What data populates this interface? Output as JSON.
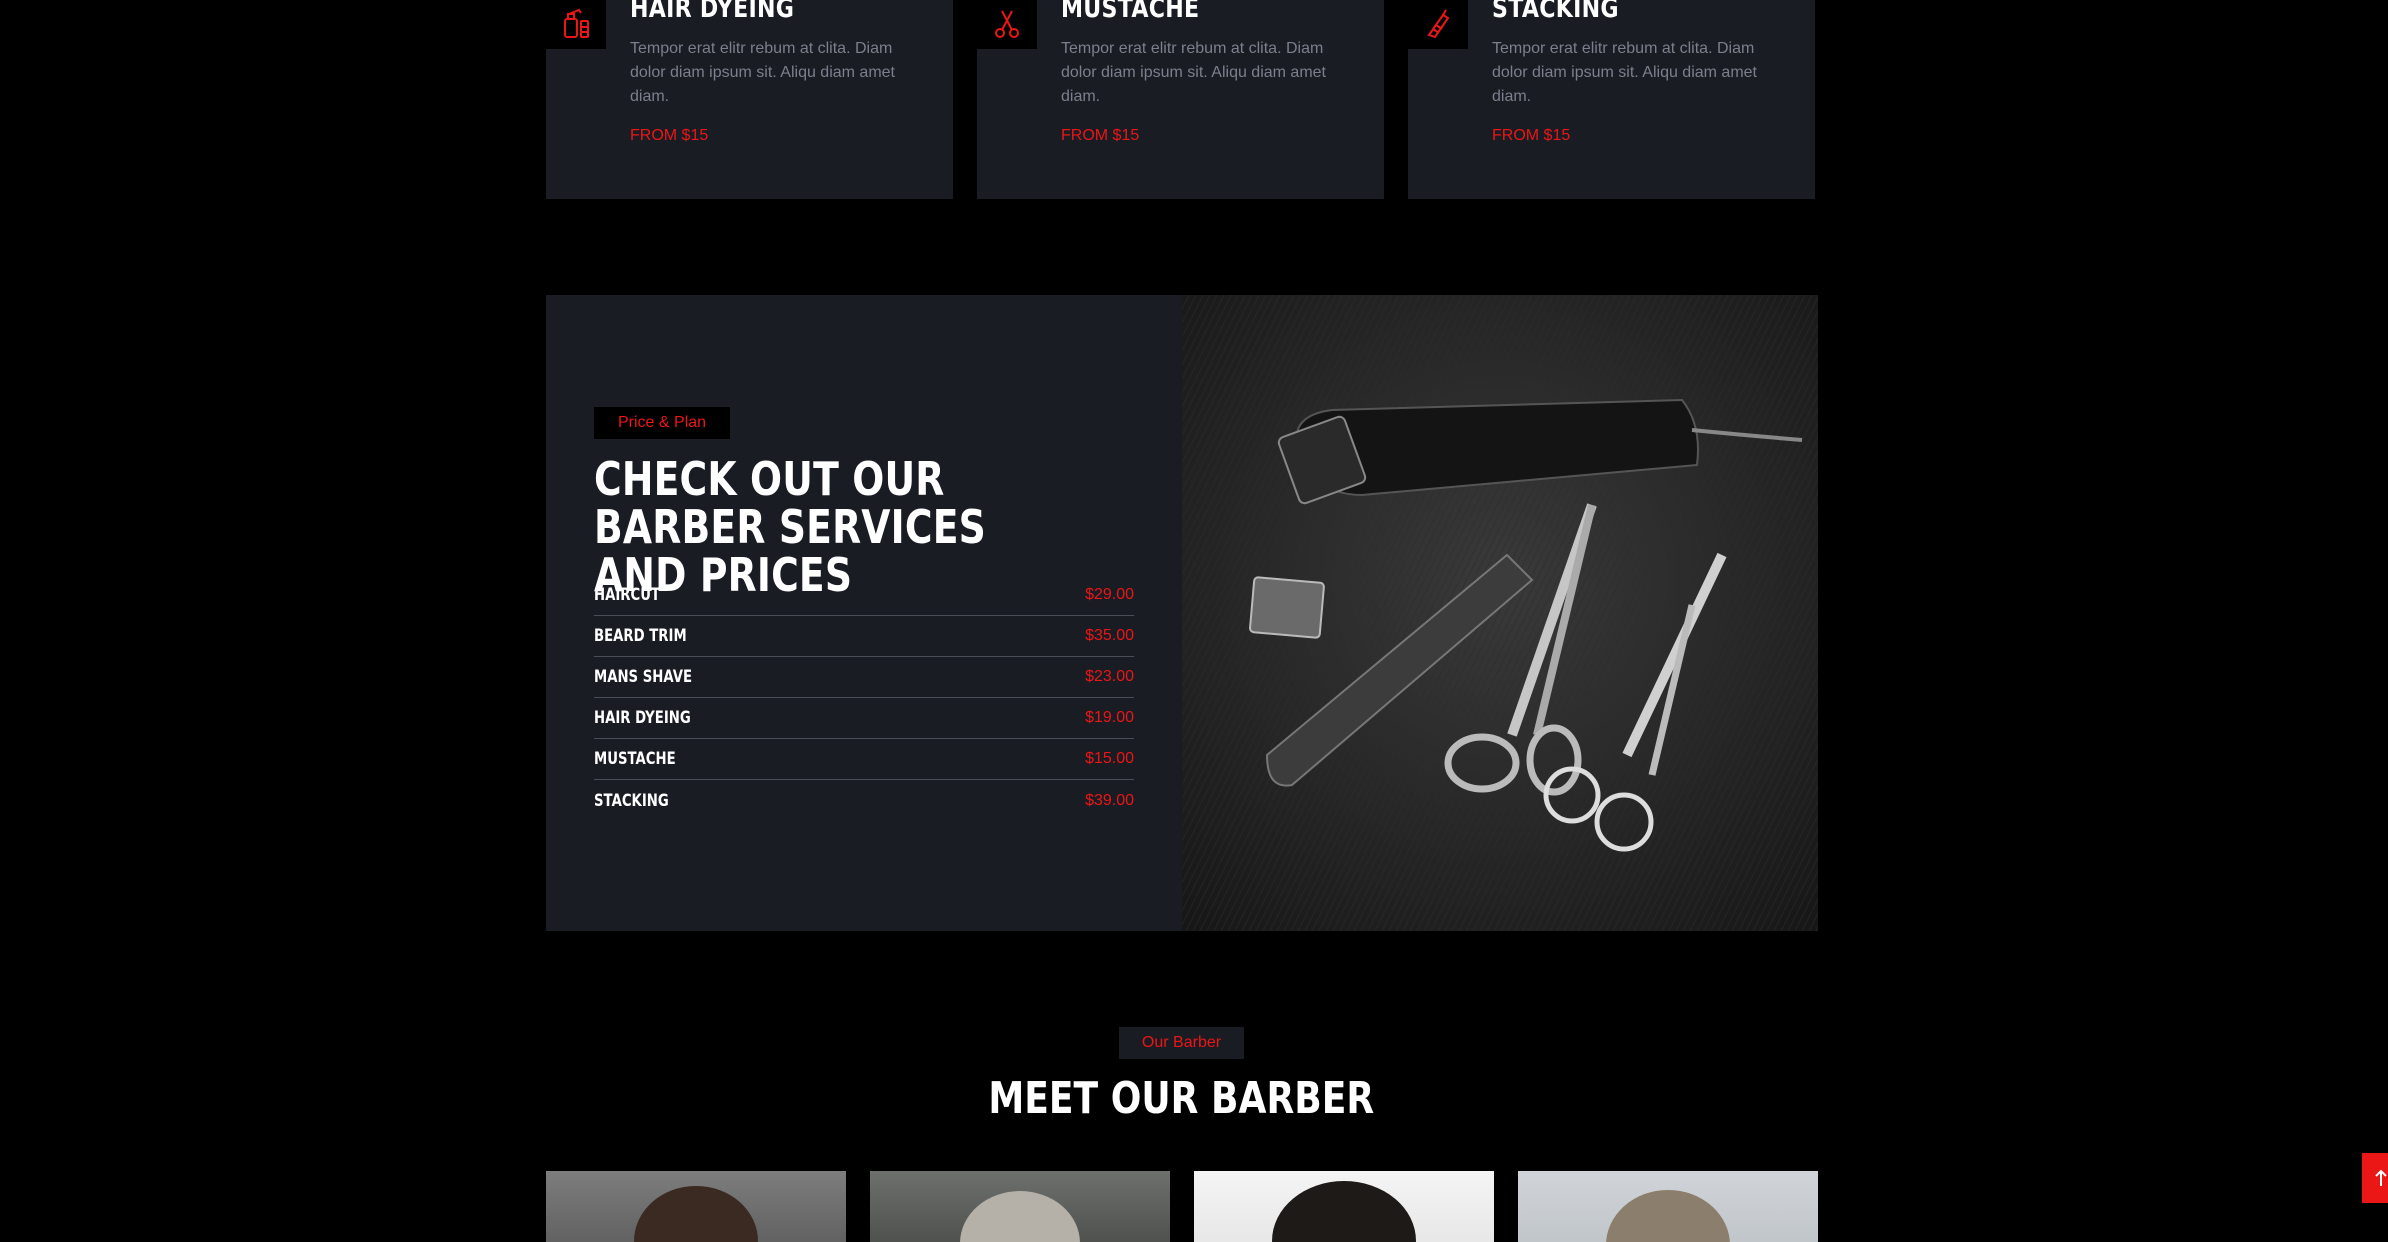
{
  "services": [
    {
      "title": "Hair Dyeing",
      "icon": "hair-dye-icon",
      "description": "Tempor erat elitr rebum at clita. Diam dolor diam ipsum sit. Aliqu diam amet diam.",
      "price": "FROM $15"
    },
    {
      "title": "Mustache",
      "icon": "scissors-icon",
      "description": "Tempor erat elitr rebum at clita. Diam dolor diam ipsum sit. Aliqu diam amet diam.",
      "price": "FROM $15"
    },
    {
      "title": "Stacking",
      "icon": "razor-icon",
      "description": "Tempor erat elitr rebum at clita. Diam dolor diam ipsum sit. Aliqu diam amet diam.",
      "price": "FROM $15"
    }
  ],
  "pricing": {
    "tag": "Price & Plan",
    "heading": "Check Out Our Barber Services And Prices",
    "image": "barber-tools-photo",
    "items": [
      {
        "name": "Haircut",
        "price": "$29.00"
      },
      {
        "name": "Beard Trim",
        "price": "$35.00"
      },
      {
        "name": "Mans Shave",
        "price": "$23.00"
      },
      {
        "name": "Hair Dyeing",
        "price": "$19.00"
      },
      {
        "name": "Mustache",
        "price": "$15.00"
      },
      {
        "name": "Stacking",
        "price": "$39.00"
      }
    ]
  },
  "team": {
    "tag": "Our Barber",
    "heading": "Meet Our Barber",
    "photos": [
      "barber-photo",
      "barber-photo",
      "barber-photo",
      "barber-photo"
    ]
  },
  "back_to_top": {
    "icon": "arrow-up-icon"
  },
  "colors": {
    "accent": "#eb1616",
    "card": "#1a1c24",
    "background": "#000000"
  }
}
